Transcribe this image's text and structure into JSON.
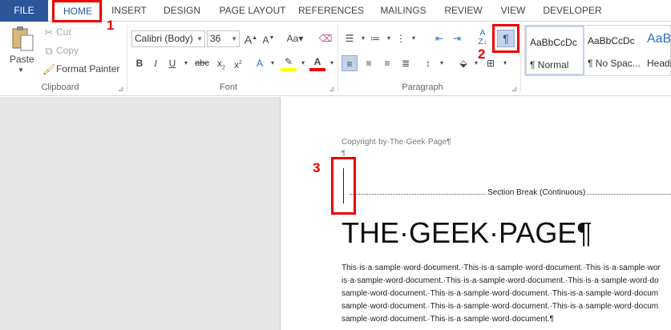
{
  "tabs": [
    {
      "label": "FILE"
    },
    {
      "label": "HOME"
    },
    {
      "label": "INSERT"
    },
    {
      "label": "DESIGN"
    },
    {
      "label": "PAGE LAYOUT"
    },
    {
      "label": "REFERENCES"
    },
    {
      "label": "MAILINGS"
    },
    {
      "label": "REVIEW"
    },
    {
      "label": "VIEW"
    },
    {
      "label": "DEVELOPER"
    }
  ],
  "clipboard": {
    "paste_label": "Paste",
    "cut_label": "Cut",
    "copy_label": "Copy",
    "format_painter_label": "Format Painter",
    "group_label": "Clipboard"
  },
  "font": {
    "font_name": "Calibri (Body)",
    "font_size": "36",
    "group_label": "Font"
  },
  "paragraph": {
    "group_label": "Paragraph"
  },
  "styles": {
    "items": [
      {
        "preview": "AaBbCcDc",
        "name": "¶ Normal"
      },
      {
        "preview": "AaBbCcDc",
        "name": "¶ No Spac..."
      },
      {
        "preview": "AaB",
        "name": "Headi"
      }
    ]
  },
  "document": {
    "header": "Copyright·by·The·Geek·Page¶",
    "pilcrow": "¶",
    "section_break": "Section Break (Continuous)",
    "title": "THE·GEEK·PAGE¶",
    "body_lines": [
      "This·is·a·sample·word·document.·This·is·a·sample·word·document.·This·is·a·sample·wor",
      "is·a·sample·word·document.·This·is·a·sample·word·document.·This·is·a·sample·word·do",
      "sample·word·document.·This·is·a·sample·word·document.·This·is·a·sample·word·docum",
      "sample·word·document.·This·is·a·sample·word·document.·This·is·a·sample·word·docum",
      "sample·word·document.·This·is·a·sample·word·document.¶"
    ]
  },
  "annotations": [
    "1",
    "2",
    "3"
  ],
  "colors": {
    "file_tab": "#2b579a",
    "annotation": "#ee0000"
  }
}
